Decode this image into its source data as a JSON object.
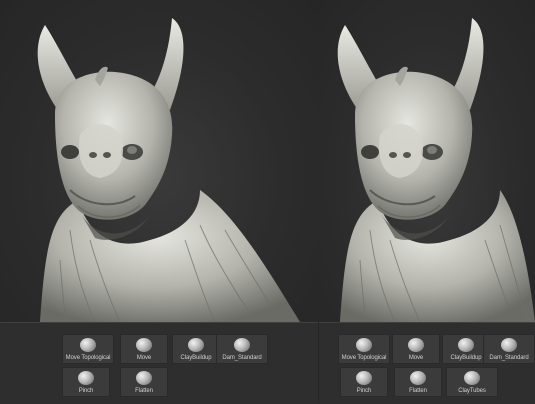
{
  "left_panel": {
    "brushes": [
      {
        "label": "Move Topological",
        "icon": "move-topological-brush-icon"
      },
      {
        "label": "Move",
        "icon": "move-brush-icon"
      },
      {
        "label": "ClayBuildup",
        "icon": "claybuildup-brush-icon"
      },
      {
        "label": "Dam_Standard",
        "icon": "dam-standard-brush-icon"
      },
      {
        "label": "Pinch",
        "icon": "pinch-brush-icon"
      },
      {
        "label": "Flatten",
        "icon": "flatten-brush-icon"
      }
    ]
  },
  "right_panel": {
    "brushes": [
      {
        "label": "Move Topological",
        "icon": "move-topological-brush-icon"
      },
      {
        "label": "Move",
        "icon": "move-brush-icon"
      },
      {
        "label": "ClayBuildup",
        "icon": "claybuildup-brush-icon"
      },
      {
        "label": "Dam_Standard",
        "icon": "dam-standard-brush-icon"
      },
      {
        "label": "Pinch",
        "icon": "pinch-brush-icon"
      },
      {
        "label": "Flatten",
        "icon": "flatten-brush-icon"
      },
      {
        "label": "ClayTubes",
        "icon": "claytubes-brush-icon"
      }
    ]
  },
  "colors": {
    "background": "#2b2b2b",
    "sculpt_material": "#c9c9c3",
    "shelf": "#2e2e2e",
    "button": "#3b3b3b",
    "label_text": "#d0d0d0"
  }
}
